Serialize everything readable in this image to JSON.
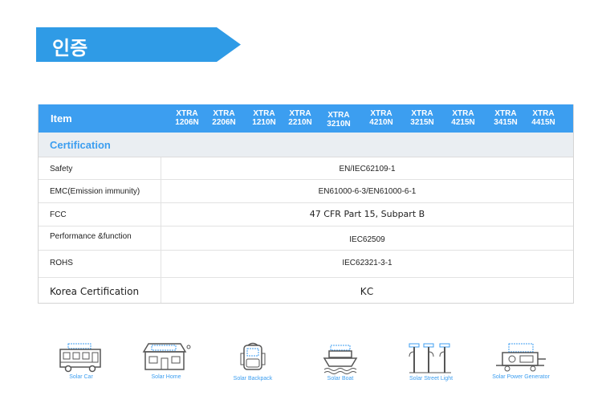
{
  "header": {
    "title": "인증"
  },
  "table": {
    "item_label": "Item",
    "models": [
      [
        "XTRA",
        "1206N"
      ],
      [
        "XTRA",
        "2206N"
      ],
      [
        "XTRA",
        "1210N"
      ],
      [
        "XTRA",
        "2210N"
      ],
      [
        "XTRA",
        "3210N"
      ],
      [
        "XTRA",
        "4210N"
      ],
      [
        "XTRA",
        "3215N"
      ],
      [
        "XTRA",
        "4215N"
      ],
      [
        "XTRA",
        "3415N"
      ],
      [
        "XTRA",
        "4415N"
      ]
    ],
    "section": "Certification",
    "rows": [
      {
        "label": "Safety",
        "value": "EN/IEC62109-1"
      },
      {
        "label": "EMC(Emission immunity)",
        "value": "EN61000-6-3/EN61000-6-1"
      },
      {
        "label": "FCC",
        "value": "47 CFR Part 15, Subpart B"
      },
      {
        "label": "Performance &function",
        "value": "IEC62509"
      },
      {
        "label": "ROHS",
        "value": "IEC62321-3-1"
      },
      {
        "label": "Korea Certification",
        "value": "KC"
      }
    ]
  },
  "applications": [
    {
      "icon": "solar-car-icon",
      "caption": "Solar Car"
    },
    {
      "icon": "solar-home-icon",
      "caption": "Solar Home"
    },
    {
      "icon": "solar-backpack-icon",
      "caption": "Solar Backpack"
    },
    {
      "icon": "solar-boat-icon",
      "caption": "Solar Boat"
    },
    {
      "icon": "solar-street-light-icon",
      "caption": "Solar Street Light"
    },
    {
      "icon": "solar-power-generator-icon",
      "caption": "Solar Power Generator"
    }
  ],
  "colors": {
    "accent": "#3c9ef0",
    "banner": "#2f9be6",
    "section_bg": "#eaeef2"
  }
}
